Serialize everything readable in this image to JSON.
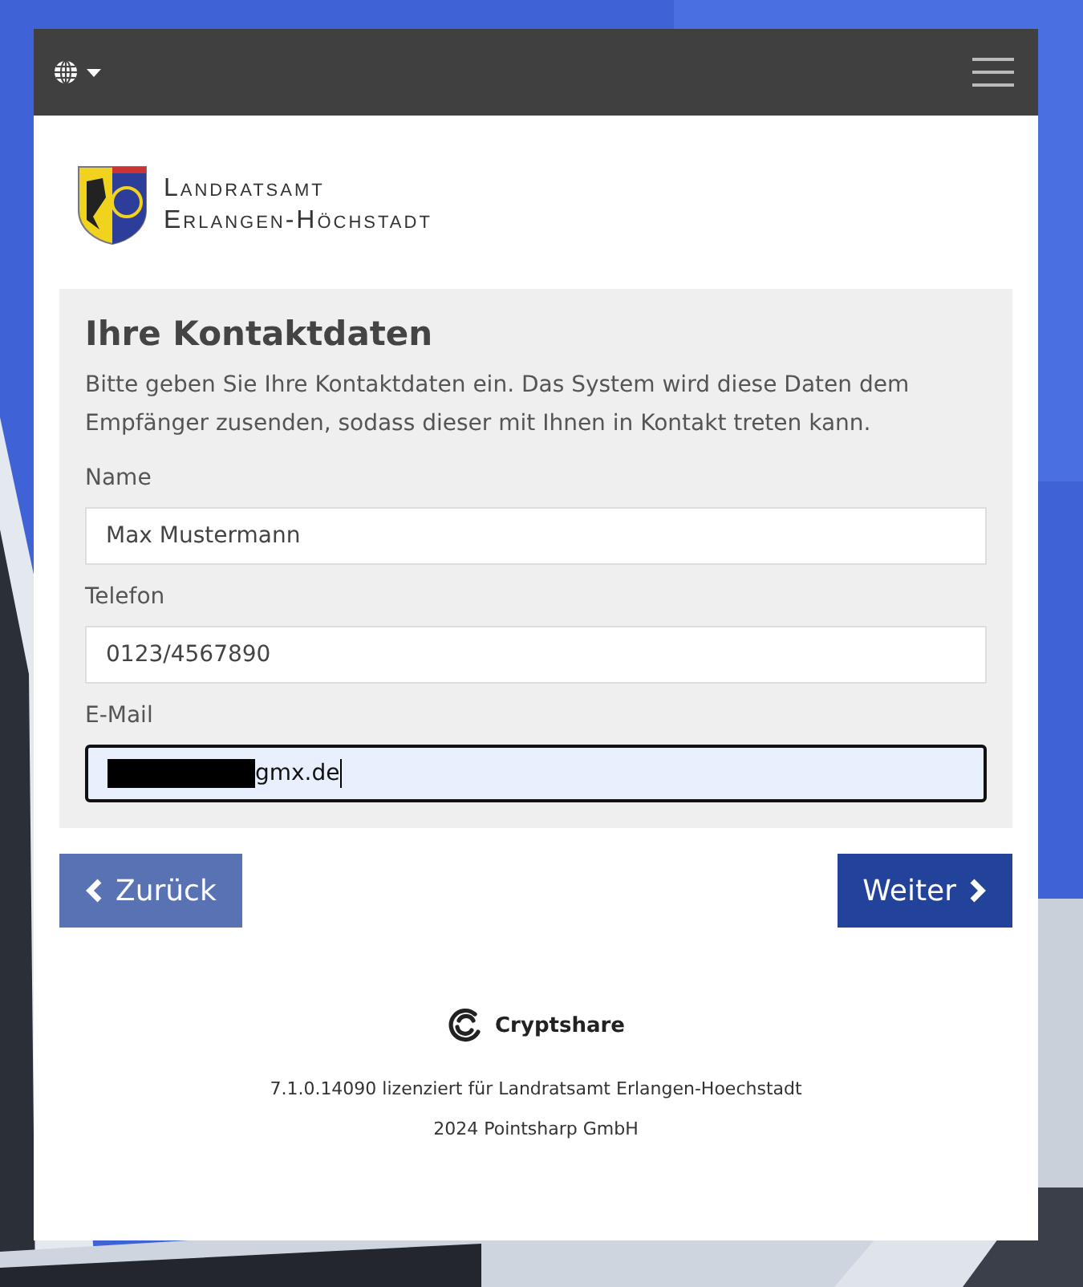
{
  "navbar": {
    "language_menu": {
      "expanded": false
    }
  },
  "logo": {
    "line_1": "Landratsamt",
    "line_2": "Erlangen-Höchstadt"
  },
  "form": {
    "title": "Ihre Kontaktdaten",
    "description": "Bitte geben Sie Ihre Kontaktdaten ein. Das System wird diese Daten dem Empfänger zusenden, sodass dieser mit Ihnen in Kontakt treten kann.",
    "fields": [
      {
        "label": "Name",
        "value": "Max Mustermann",
        "focused": false,
        "redacted": false
      },
      {
        "label": "Telefon",
        "value": "0123/4567890",
        "focused": false,
        "redacted": false
      },
      {
        "label": "E-Mail",
        "value": "gmx.de",
        "focused": true,
        "redacted": true
      }
    ]
  },
  "buttons": [
    {
      "label": "Zurück",
      "kind": "back"
    },
    {
      "label": "Weiter",
      "kind": "next"
    }
  ],
  "footer": {
    "brand": "Cryptshare",
    "license": "7.1.0.14090 lizenziert für Landratsamt Erlangen-Hoechstadt",
    "copyright": "2024 Pointsharp GmbH"
  }
}
